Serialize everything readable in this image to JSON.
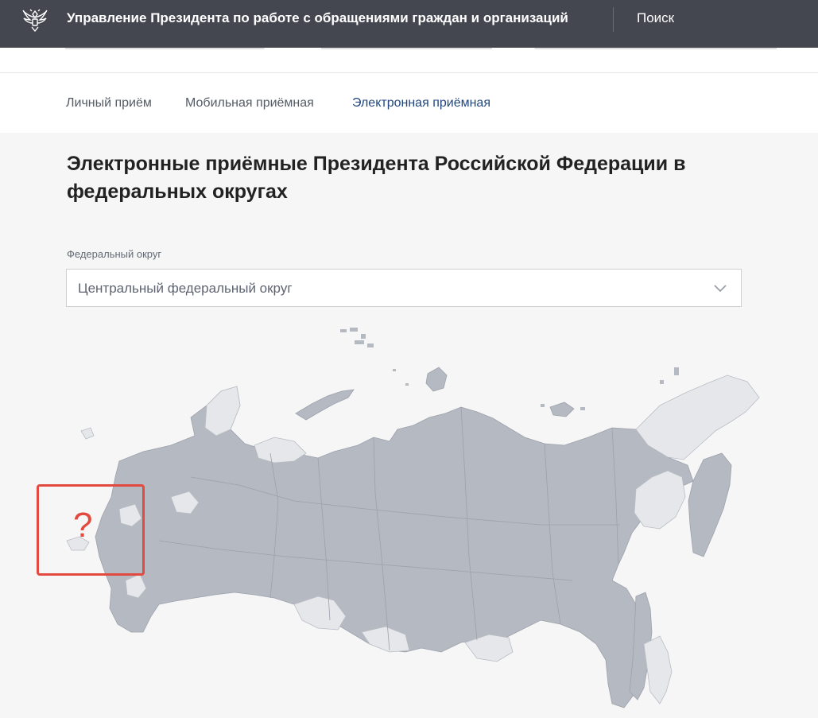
{
  "header": {
    "site_title": "Управление Президента по работе с обращениями граждан и организаций",
    "search_label": "Поиск",
    "emblem_icon": "double-headed-eagle-emblem"
  },
  "tabs": [
    {
      "label": "Личный приём",
      "active": false
    },
    {
      "label": "Мобильная приёмная",
      "active": false
    },
    {
      "label": "Электронная приёмная",
      "active": true
    }
  ],
  "main": {
    "title_line1": "Электронные приёмные Президента Российской Федерации в",
    "title_line2": "федеральных округах",
    "district_field": {
      "label": "Федеральный округ",
      "value": "Центральный федеральный округ",
      "icon": "chevron-down-icon"
    }
  },
  "map": {
    "highlight_mark": "?",
    "colors": {
      "region_dark": "#b5b9c2",
      "region_light": "#e6e7ea",
      "highlight": "#e24a3f",
      "accent": "#22477e"
    }
  }
}
